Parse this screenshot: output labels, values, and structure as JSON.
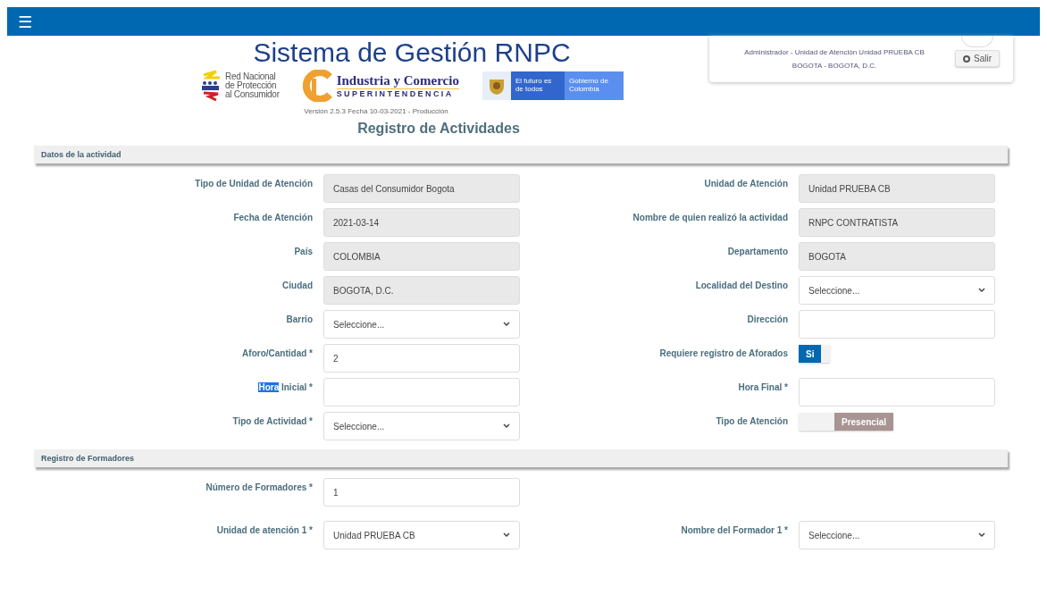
{
  "topbar": {
    "menu_icon": "☰"
  },
  "header": {
    "title": "Sistema de Gestión RNPC",
    "logos": [
      {
        "kind": "rnpc",
        "lines": [
          "Red Nacional",
          "de Protección",
          "al Consumidor"
        ]
      },
      {
        "kind": "sic",
        "lines": [
          "Industria y Comercio",
          "SUPERINTENDENCIA"
        ]
      },
      {
        "kind": "gov",
        "lines": [
          "El futuro es de todos",
          "Gobierno de Colombia"
        ]
      }
    ],
    "version": "Versión 2.5.3 Fecha 10-03-2021 - Producción"
  },
  "user": {
    "role": "Administrador - Unidad de Atención Unidad PRUEBA CB",
    "location": "BOGOTA - BOGOTA, D.C.",
    "logout": "Salir"
  },
  "page_title": "Registro de Actividades",
  "sections": [
    {
      "title": "Datos de la actividad",
      "rows": [
        {
          "left": {
            "label": [
              {
                "text": "Tipo de Unidad de Atención",
                "highlighted": false
              }
            ],
            "kind": "readonly",
            "value": "Casas del Consumidor Bogota"
          },
          "right": {
            "label": [
              {
                "text": "Unidad de Atención",
                "highlighted": false
              }
            ],
            "kind": "readonly",
            "value": "Unidad PRUEBA CB"
          }
        },
        {
          "left": {
            "label": [
              {
                "text": "Fecha de Atención",
                "highlighted": false
              }
            ],
            "kind": "readonly",
            "value": "2021-03-14"
          },
          "right": {
            "label": [
              {
                "text": "Nombre de quien realizó la actividad",
                "highlighted": false
              }
            ],
            "kind": "readonly",
            "value": "RNPC CONTRATISTA"
          }
        },
        {
          "left": {
            "label": [
              {
                "text": "País",
                "highlighted": false
              }
            ],
            "kind": "readonly",
            "value": "COLOMBIA"
          },
          "right": {
            "label": [
              {
                "text": "Departamento",
                "highlighted": false
              }
            ],
            "kind": "readonly",
            "value": "BOGOTA"
          }
        },
        {
          "left": {
            "label": [
              {
                "text": "Ciudad",
                "highlighted": false
              }
            ],
            "kind": "readonly",
            "value": "BOGOTA, D.C."
          },
          "right": {
            "label": [
              {
                "text": "Localidad del Destino",
                "highlighted": false
              }
            ],
            "kind": "select",
            "value": "Seleccione..."
          }
        },
        {
          "left": {
            "label": [
              {
                "text": "Barrio",
                "highlighted": false
              }
            ],
            "kind": "select",
            "value": "Seleccione..."
          },
          "right": {
            "label": [
              {
                "text": "Dirección",
                "highlighted": false
              }
            ],
            "kind": "input"
          }
        },
        {
          "left": {
            "label": [
              {
                "text": "Aforo/Cantidad *",
                "highlighted": false
              }
            ],
            "kind": "input",
            "value": "2"
          },
          "right": {
            "label": [
              {
                "text": "Requiere registro de Aforados",
                "highlighted": false
              }
            ],
            "kind": "toggle",
            "on": true,
            "value": "Si"
          }
        },
        {
          "left": {
            "label": [
              {
                "text": "Hora",
                "highlighted": true
              },
              {
                "text": " Inicial *",
                "highlighted": false
              }
            ],
            "kind": "input"
          },
          "right": {
            "label": [
              {
                "text": "Hora Final *",
                "highlighted": false
              }
            ],
            "kind": "input"
          }
        },
        {
          "left": {
            "label": [
              {
                "text": "Tipo de Actividad *",
                "highlighted": false
              }
            ],
            "kind": "select",
            "value": "Seleccione..."
          },
          "right": {
            "label": [
              {
                "text": "Tipo de Atención",
                "highlighted": false
              }
            ],
            "kind": "toggle",
            "on": false,
            "value": "Presencial"
          }
        }
      ]
    },
    {
      "title": "Registro de Formadores",
      "rows": [
        {
          "left": {
            "label": [
              {
                "text": "Número de Formadores *",
                "highlighted": false
              }
            ],
            "kind": "input",
            "value": "1"
          }
        },
        {
          "left": {
            "label": [
              {
                "text": "Unidad de atención 1 *",
                "highlighted": false
              }
            ],
            "kind": "select",
            "value": "Unidad PRUEBA CB"
          },
          "right": {
            "label": [
              {
                "text": "Nombre del Formador 1 *",
                "highlighted": false
              }
            ],
            "kind": "select",
            "value": "Seleccione..."
          }
        }
      ]
    }
  ]
}
